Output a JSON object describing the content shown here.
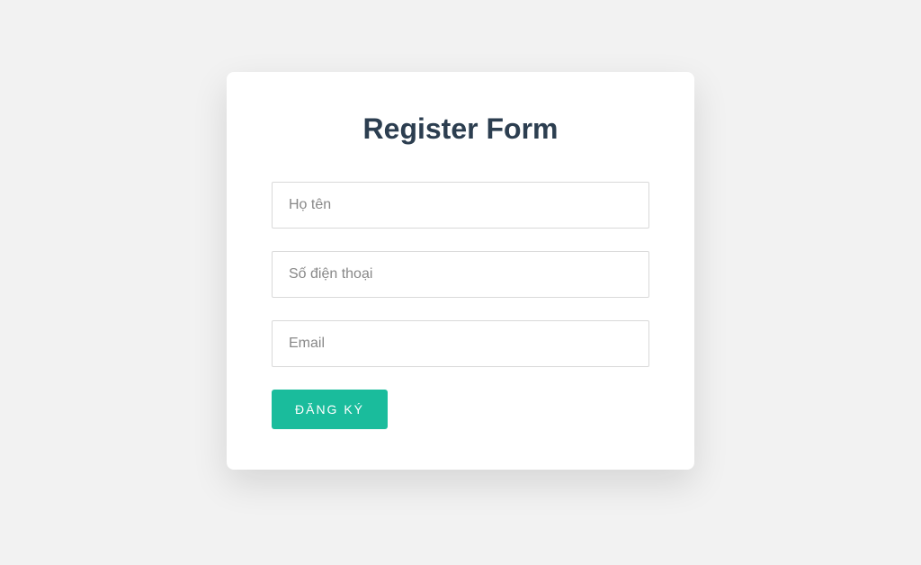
{
  "form": {
    "title": "Register Form",
    "fields": {
      "name": {
        "placeholder": "Họ tên",
        "value": ""
      },
      "phone": {
        "placeholder": "Số điện thoại",
        "value": ""
      },
      "email": {
        "placeholder": "Email",
        "value": ""
      }
    },
    "submit_label": "Đăng ký"
  }
}
